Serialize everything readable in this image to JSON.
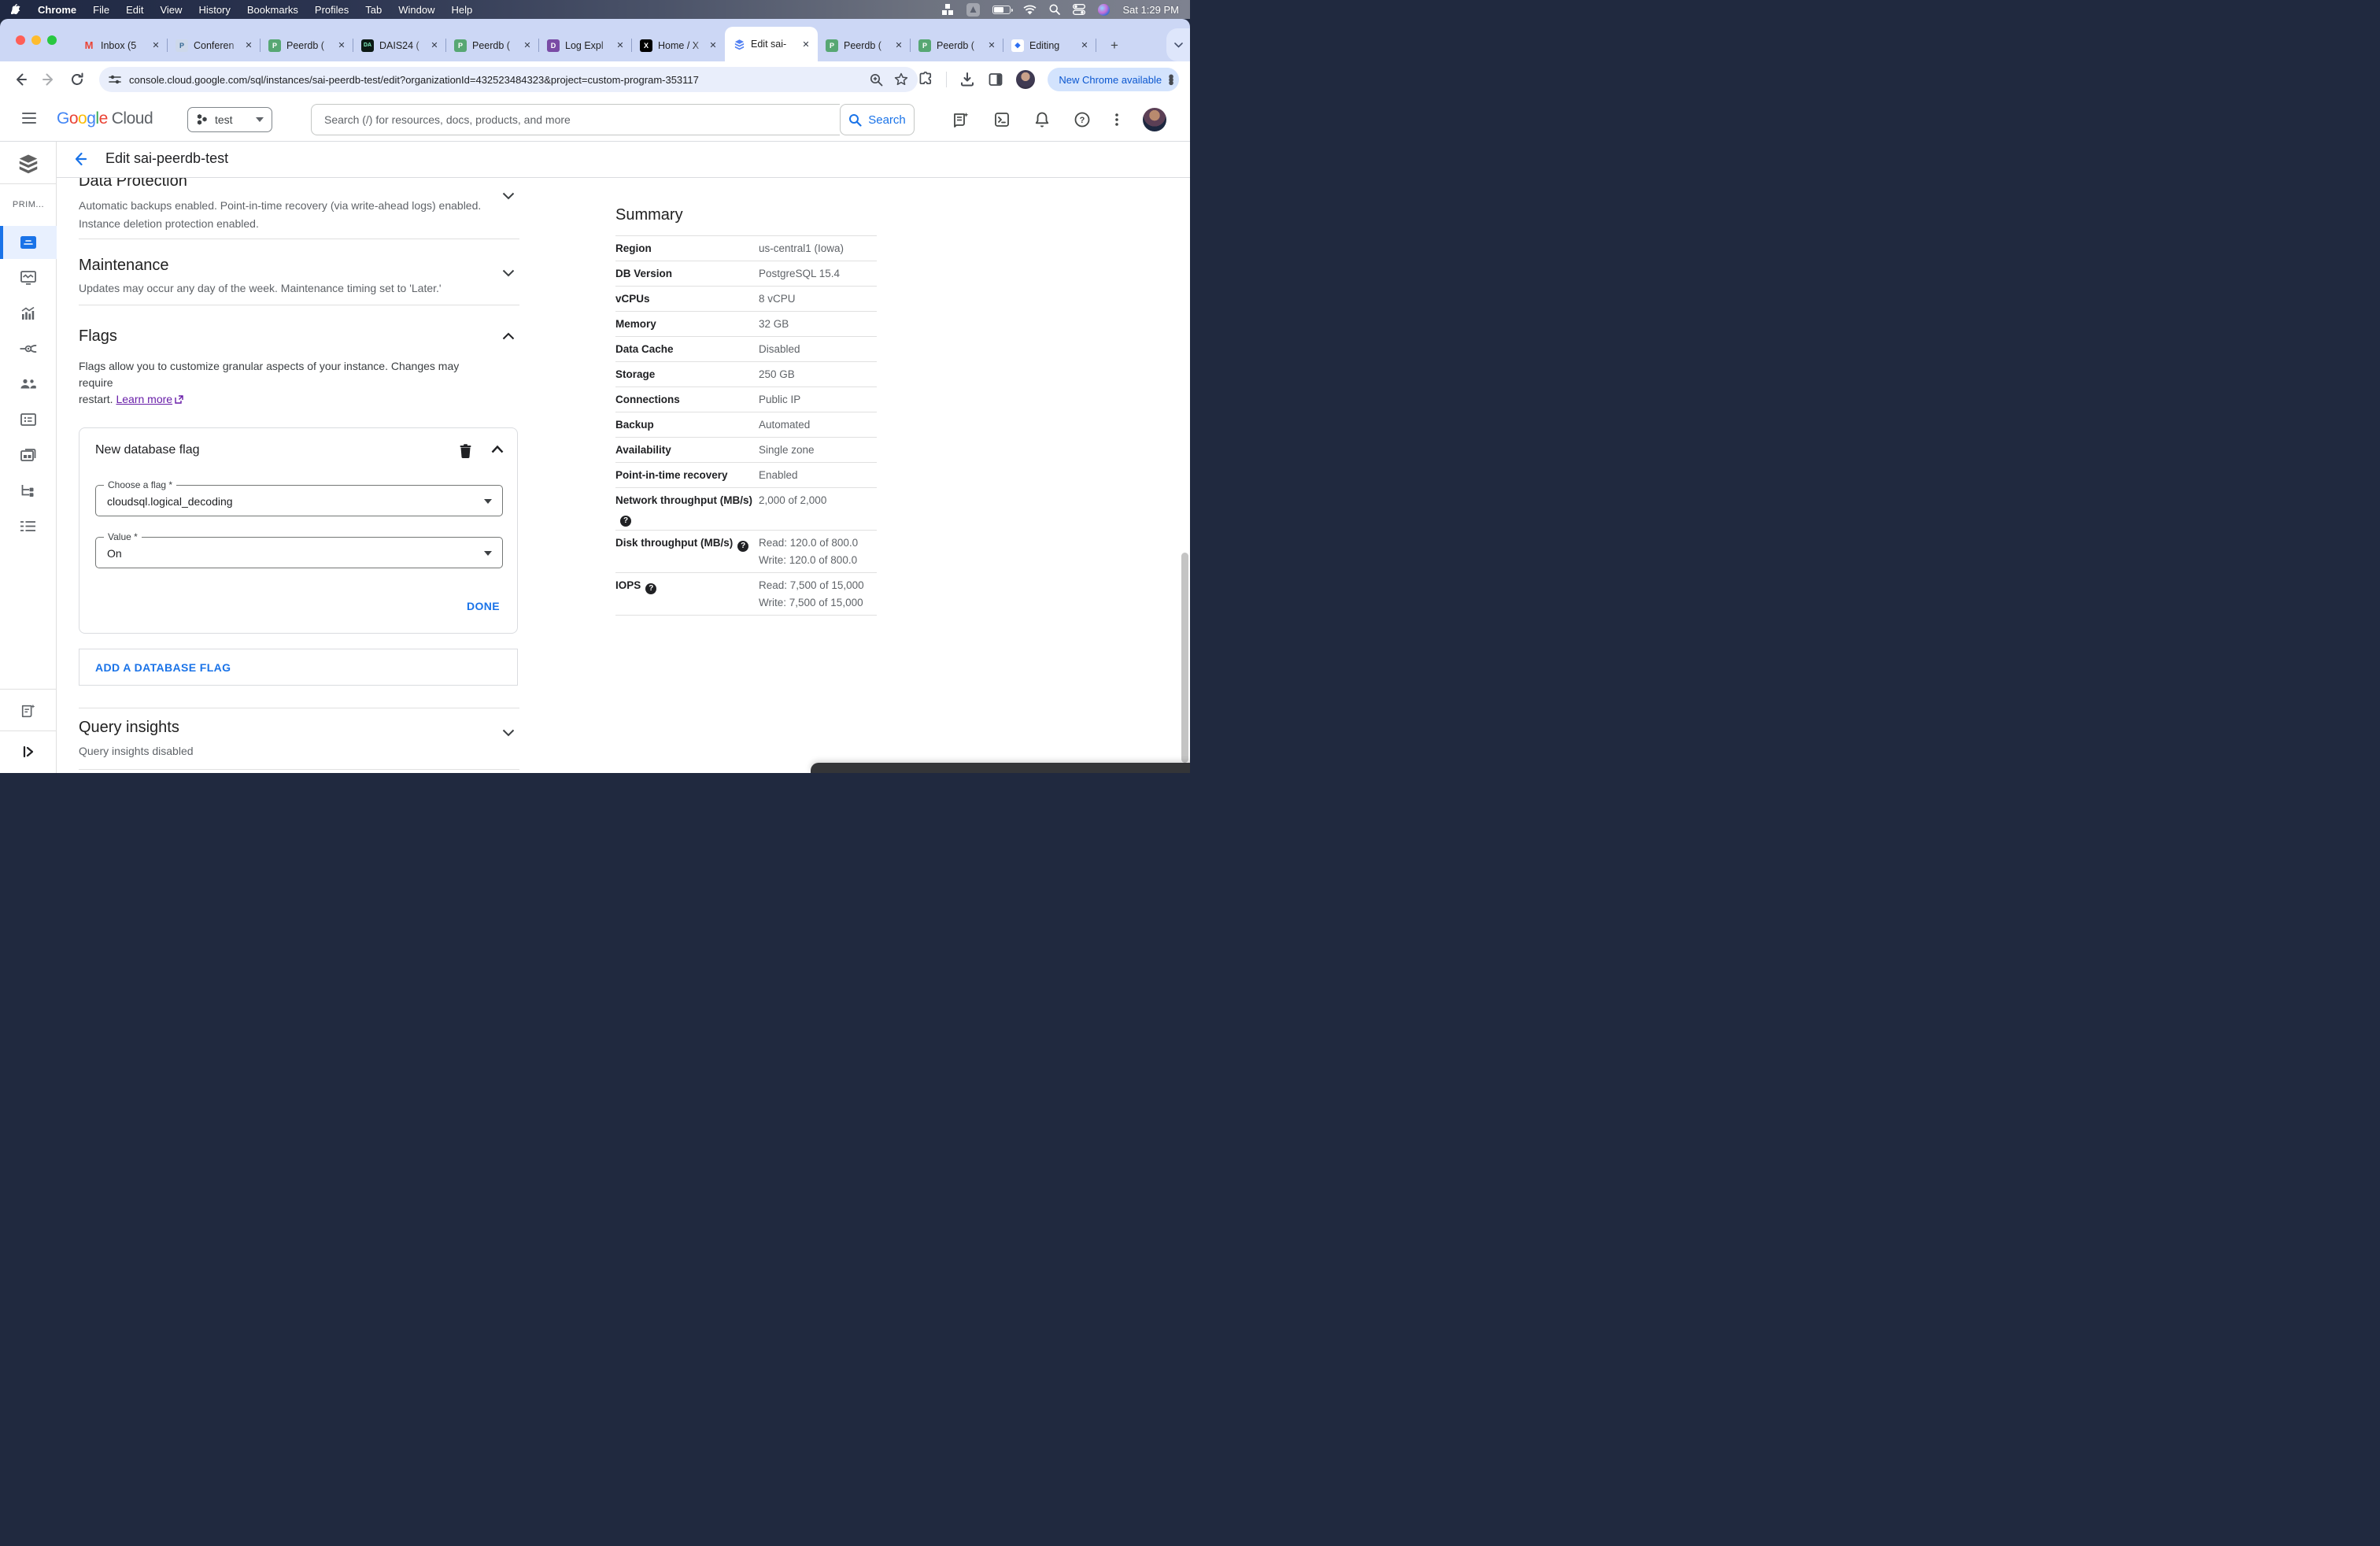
{
  "menu_bar": {
    "items": [
      "Chrome",
      "File",
      "Edit",
      "View",
      "History",
      "Bookmarks",
      "Profiles",
      "Tab",
      "Window",
      "Help"
    ],
    "clock": "Sat 1:29 PM"
  },
  "tab_strip": {
    "tabs": [
      {
        "title": "Inbox (5",
        "icon": "gmail"
      },
      {
        "title": "Conferen",
        "icon": "postgres"
      },
      {
        "title": "Peerdb (",
        "icon": "peerdb"
      },
      {
        "title": "DAIS24 (",
        "icon": "dais"
      },
      {
        "title": "Peerdb (",
        "icon": "peerdb"
      },
      {
        "title": "Log Expl",
        "icon": "datadog"
      },
      {
        "title": "Home / X",
        "icon": "x"
      },
      {
        "title": "Edit sai-",
        "icon": "cloudsql",
        "active": true
      },
      {
        "title": "Peerdb (",
        "icon": "peerdb"
      },
      {
        "title": "Peerdb (",
        "icon": "peerdb"
      },
      {
        "title": "Editing",
        "icon": "docs"
      }
    ],
    "favicons": {
      "gmail": {
        "bg": "transparent",
        "fg": "#ea4335",
        "glyph": "M"
      },
      "postgres": {
        "bg": "#cdd8ea",
        "fg": "#336791",
        "glyph": "P"
      },
      "peerdb": {
        "bg": "#57a773",
        "fg": "#ffffff",
        "glyph": "P"
      },
      "dais": {
        "bg": "#0c1a14",
        "fg": "#7ef0c0",
        "glyph": "DA"
      },
      "datadog": {
        "bg": "#7a4ba5",
        "fg": "#ffffff",
        "glyph": "D"
      },
      "x": {
        "bg": "#000000",
        "fg": "#ffffff",
        "glyph": "X"
      },
      "docs": {
        "bg": "#ffffff",
        "fg": "#2d6ff2",
        "glyph": "◆"
      }
    }
  },
  "toolbar": {
    "url": "console.cloud.google.com/sql/instances/sai-peerdb-test/edit?organizationId=432523484323&project=custom-program-353117",
    "new_chrome_label": "New Chrome available"
  },
  "gcp_header": {
    "logo_google": "Google",
    "logo_cloud": "Cloud",
    "project_name": "test",
    "search_placeholder": "Search (/) for resources, docs, products, and more",
    "search_button_label": "Search"
  },
  "sidebar": {
    "section_label": "PRIM..."
  },
  "page": {
    "title": "Edit sai-peerdb-test"
  },
  "sections": {
    "data_protection": {
      "title": "Data Protection",
      "line1": "Automatic backups enabled. Point-in-time recovery (via write-ahead logs) enabled.",
      "line2": "Instance deletion protection enabled."
    },
    "maintenance": {
      "title": "Maintenance",
      "desc": "Updates may occur any day of the week. Maintenance timing set to 'Later.'"
    },
    "flags": {
      "title": "Flags",
      "desc_line1": "Flags allow you to customize granular aspects of your instance. Changes may require",
      "desc_line2": "restart.",
      "learn_more": "Learn more"
    },
    "query_insights": {
      "title": "Query insights",
      "status": "Query insights disabled"
    }
  },
  "flag_card": {
    "title": "New database flag",
    "choose_label": "Choose a flag *",
    "choose_value": "cloudsql.logical_decoding",
    "value_label": "Value *",
    "value_value": "On",
    "done_label": "DONE"
  },
  "add_flag_label": "ADD A DATABASE FLAG",
  "summary": {
    "title": "Summary",
    "rows": [
      {
        "label": "Region",
        "values": [
          "us-central1 (Iowa)"
        ]
      },
      {
        "label": "DB Version",
        "values": [
          "PostgreSQL 15.4"
        ]
      },
      {
        "label": "vCPUs",
        "values": [
          "8 vCPU"
        ]
      },
      {
        "label": "Memory",
        "values": [
          "32 GB"
        ]
      },
      {
        "label": "Data Cache",
        "values": [
          "Disabled"
        ]
      },
      {
        "label": "Storage",
        "values": [
          "250 GB"
        ]
      },
      {
        "label": "Connections",
        "values": [
          "Public IP"
        ]
      },
      {
        "label": "Backup",
        "values": [
          "Automated"
        ]
      },
      {
        "label": "Availability",
        "values": [
          "Single zone"
        ]
      },
      {
        "label": "Point-in-time recovery",
        "values": [
          "Enabled"
        ]
      },
      {
        "label": "Network throughput (MB/s)",
        "help": true,
        "values": [
          "2,000 of 2,000"
        ]
      },
      {
        "label": "Disk throughput (MB/s)",
        "help": true,
        "values": [
          "Read: 120.0 of 800.0",
          "Write: 120.0 of 800.0"
        ]
      },
      {
        "label": "IOPS",
        "help": true,
        "values": [
          "Read: 7,500 of 15,000",
          "Write: 7,500 of 15,000"
        ]
      }
    ]
  },
  "colors": {
    "accent_blue": "#1a73e8",
    "visited_purple": "#681da8",
    "active_item_bg": "#e8f0fe"
  }
}
